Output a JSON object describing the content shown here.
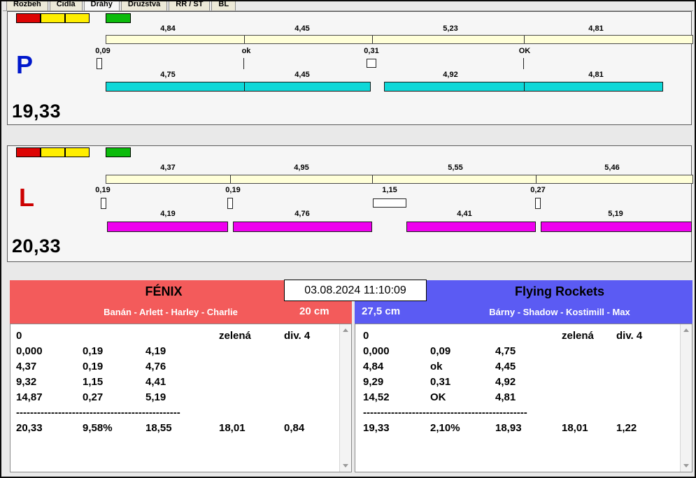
{
  "tabs": {
    "items": [
      "Rozbeh",
      "Čidlá",
      "Dráhy",
      "Družstvá",
      "RR / ST",
      "BL"
    ]
  },
  "lanes": {
    "p": {
      "letter": "P",
      "total": "19,33",
      "splits": [
        "4,84",
        "4,45",
        "5,23",
        "4,81"
      ],
      "crosses": [
        "0,09",
        "ok",
        "0,31",
        "OK"
      ],
      "legs": [
        "4,75",
        "4,45",
        "4,92",
        "4,81"
      ]
    },
    "l": {
      "letter": "L",
      "total": "20,33",
      "splits": [
        "4,37",
        "4,95",
        "5,55",
        "5,46"
      ],
      "crosses": [
        "0,19",
        "0,19",
        "1,15",
        "0,27"
      ],
      "legs": [
        "4,19",
        "4,76",
        "4,41",
        "5,19"
      ]
    }
  },
  "center": {
    "timestamp": "03.08.2024 11:10:09"
  },
  "teams": {
    "left": {
      "name": "FÉNIX",
      "members": "Banán - Arlett - Harley - Charlie",
      "jump_height": "20 cm",
      "start_value": "0",
      "status": "zelená",
      "division": "div. 4",
      "rows": [
        {
          "cum": "0,000",
          "cross": "0,19",
          "split": "4,19"
        },
        {
          "cum": "4,37",
          "cross": "0,19",
          "split": "4,76"
        },
        {
          "cum": "9,32",
          "cross": "1,15",
          "split": "4,41"
        },
        {
          "cum": "14,87",
          "cross": "0,27",
          "split": "5,19"
        }
      ],
      "separator": "-----------------------------------------------",
      "totals": {
        "time": "20,33",
        "pct": "9,58%",
        "net": "18,55",
        "ref": "18,01",
        "diff": "0,84"
      }
    },
    "right": {
      "name": "Flying Rockets",
      "members": "Bárny - Shadow - Kostimill - Max",
      "jump_height": "27,5 cm",
      "start_value": "0",
      "status": "zelená",
      "division": "div. 4",
      "rows": [
        {
          "cum": "0,000",
          "cross": "0,09",
          "split": "4,75"
        },
        {
          "cum": "4,84",
          "cross": "ok",
          "split": "4,45"
        },
        {
          "cum": "9,29",
          "cross": "0,31",
          "split": "4,92"
        },
        {
          "cum": "14,52",
          "cross": "OK",
          "split": "4,81"
        }
      ],
      "separator": "-----------------------------------------------",
      "totals": {
        "time": "19,33",
        "pct": "2,10%",
        "net": "18,93",
        "ref": "18,01",
        "diff": "1,22"
      }
    }
  },
  "colors": {
    "lane_p_bar": "#0fd8d8",
    "lane_l_bar": "#ee00ee",
    "split_bar": "#ffffd8",
    "indicator_red": "#dd0404",
    "indicator_yellow": "#ffee00",
    "indicator_green": "#0cbb0c",
    "team_left_bg": "#f35b5b",
    "team_right_bg": "#5b5bf3",
    "lane_p_letter": "#0018cc",
    "lane_l_letter": "#cc0000"
  }
}
